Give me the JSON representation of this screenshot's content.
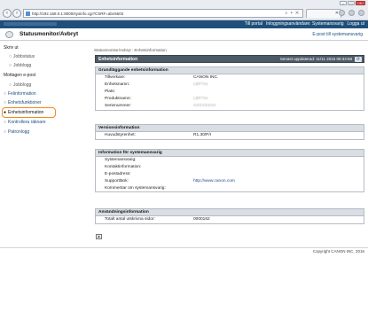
{
  "browser": {
    "url": "http://192.168.0.1:8000/sysinfo.cgi?CSRF=abc5602",
    "url_tools": "⌕ ▾ ✕",
    "tab_close": "✕"
  },
  "topnav": {
    "portal": "Till portal",
    "login_user": "Inloggningsanvändare: Systemansvarig",
    "logout": "Logga ut"
  },
  "app": {
    "title": "Statusmonitor/Avbryt",
    "email_link": "E-post till systemansvarig"
  },
  "sidebar": {
    "items": [
      {
        "label": "Skriv ut",
        "type": "head"
      },
      {
        "label": "Jobbstatus",
        "type": "sub"
      },
      {
        "label": "Jobblogg",
        "type": "sub"
      },
      {
        "label": "Mottagen e-post",
        "type": "head"
      },
      {
        "label": "Jobblogg",
        "type": "sub"
      },
      {
        "label": "Felinformation",
        "type": "item"
      },
      {
        "label": "Enhetsfunktioner",
        "type": "item"
      },
      {
        "label": "Enhetsinformation",
        "type": "item"
      },
      {
        "label": "Kontrollera räknare",
        "type": "item"
      },
      {
        "label": "Patronlogg",
        "type": "item"
      }
    ]
  },
  "main": {
    "breadcrumb": "Statusmonitor/Avbryt : Enhetsinformation",
    "page_title": "Enhetsinformation",
    "last_updated": "Senast uppdaterad: 11/11 2015 09:33:58",
    "refresh_icon": "refresh-icon",
    "sections": {
      "basic": {
        "title": "Grundläggande enhetsinformation",
        "rows": [
          {
            "k": "Tillverkare:",
            "v": "CANON INC."
          },
          {
            "k": "Enhetsnamn:",
            "v": "LBP7xx"
          },
          {
            "k": "Plats:",
            "v": ""
          },
          {
            "k": "Produktnamn:",
            "v": "LBP7xx"
          },
          {
            "k": "Serienummer:",
            "v": "XXXXXXXX"
          }
        ]
      },
      "version": {
        "title": "Versionsinformation",
        "rows": [
          {
            "k": "Huvudstyrenhet:",
            "v": "R1.30/P/I"
          }
        ]
      },
      "admin": {
        "title": "Information för systemansvarig",
        "rows": [
          {
            "k": "Systemansvarig:",
            "v": ""
          },
          {
            "k": "Kontaktinformation:",
            "v": ""
          },
          {
            "k": "E-postadress:",
            "v": ""
          },
          {
            "k": "Supportlänk:",
            "v": "http://www.canon.com"
          },
          {
            "k": "Kommentar om systemansvarig:",
            "v": ""
          }
        ]
      },
      "usage": {
        "title": "Användningsinformation",
        "rows": [
          {
            "k": "Totalt antal utskrivna sidor:",
            "v": "0000162"
          }
        ]
      }
    },
    "top_button": "▲"
  },
  "footer": {
    "copyright": "Copyright CANON INC. 2016"
  }
}
